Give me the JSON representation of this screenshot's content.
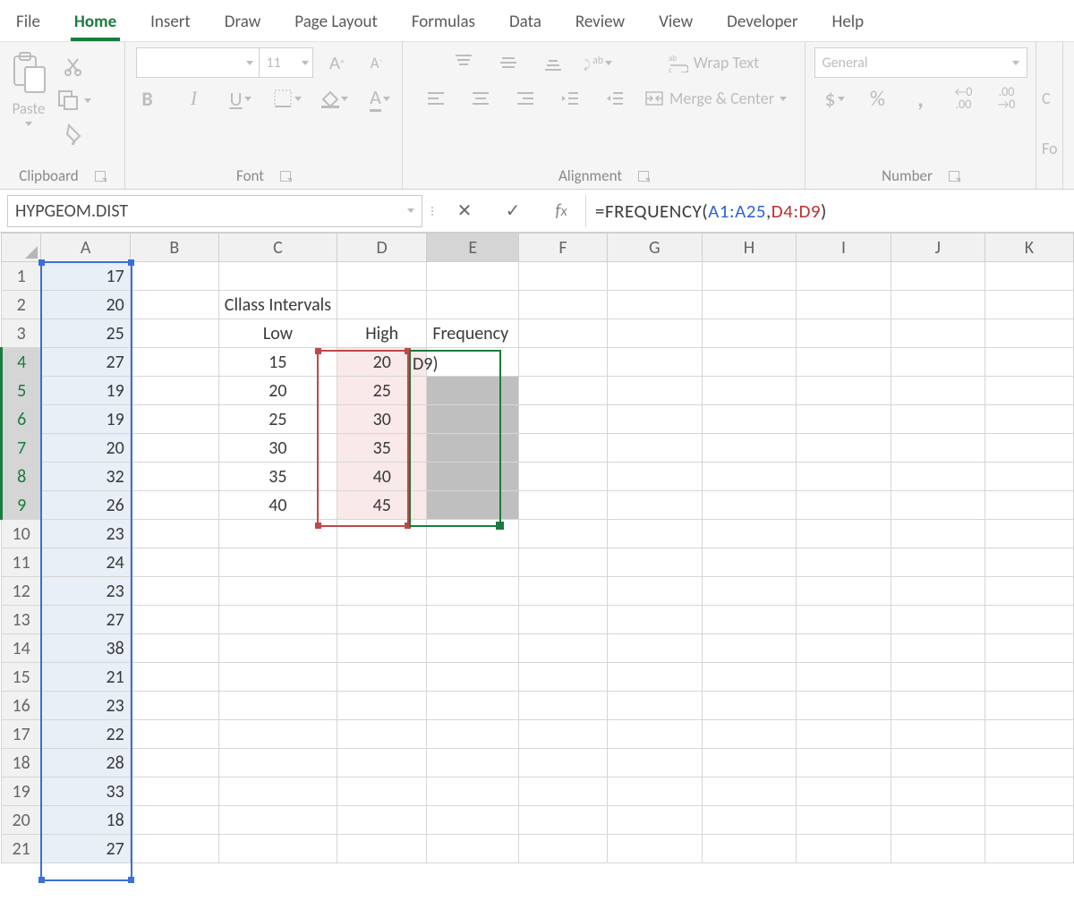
{
  "tabs": {
    "file": "File",
    "home": "Home",
    "insert": "Insert",
    "draw": "Draw",
    "page_layout": "Page Layout",
    "formulas": "Formulas",
    "data": "Data",
    "review": "Review",
    "view": "View",
    "developer": "Developer",
    "help": "Help"
  },
  "groups": {
    "clipboard": "Clipboard",
    "font": "Font",
    "alignment": "Alignment",
    "number": "Number"
  },
  "clipboard": {
    "paste": "Paste"
  },
  "font": {
    "size": "11",
    "bold": "B",
    "italic": "I",
    "underline": "U"
  },
  "alignment": {
    "wrap": "Wrap Text",
    "merge": "Merge & Center"
  },
  "number": {
    "format": "General"
  },
  "fx": {
    "name_box": "HYPGEOM.DIST",
    "formula_prefix": "=FREQUENCY(",
    "ref1": "A1:A25",
    "sep": ",",
    "ref2": "D4:D9",
    "suffix": ")"
  },
  "columns": [
    "A",
    "B",
    "C",
    "D",
    "E",
    "F",
    "G",
    "H",
    "I",
    "J",
    "K"
  ],
  "row_count": 21,
  "colA": [
    17,
    20,
    25,
    27,
    19,
    19,
    20,
    32,
    26,
    23,
    24,
    23,
    27,
    38,
    21,
    23,
    22,
    28,
    33,
    18,
    27
  ],
  "labels": {
    "class_intervals": "Cllass Intervals",
    "low": "Low",
    "high": "High",
    "frequency": "Frequency"
  },
  "low": [
    15,
    20,
    25,
    30,
    35,
    40
  ],
  "high": [
    20,
    25,
    30,
    35,
    40,
    45
  ],
  "e4_spill": "D9)",
  "col_widths": {
    "row": 45,
    "A": 103,
    "B": 103,
    "C": 103,
    "D": 103,
    "E": 103,
    "F": 103,
    "G": 110,
    "H": 110,
    "I": 110,
    "J": 110,
    "K": 103
  }
}
